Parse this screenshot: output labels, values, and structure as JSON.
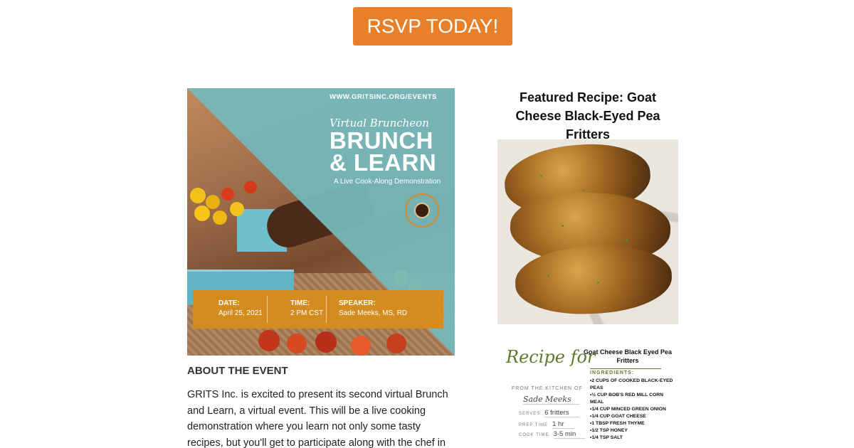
{
  "rsvp_button": {
    "label": "RSVP TODAY!",
    "color": "#e8802a"
  },
  "flyer": {
    "url": "WWW.GRITSINC.ORG/EVENTS",
    "script_title": "Virtual Bruncheon",
    "title_line1": "BRUNCH",
    "title_line2": "& LEARN",
    "subtitle": "A Live Cook-Along Demonstration",
    "info": [
      {
        "label": "DATE:",
        "value": "April 25, 2021"
      },
      {
        "label": "TIME:",
        "value": "2 PM CST"
      },
      {
        "label": "SPEAKER:",
        "value": "Sade Meeks, MS, RD"
      }
    ]
  },
  "about": {
    "heading": "ABOUT THE EVENT",
    "body": "GRITS Inc. is excited to present its second virtual Brunch and Learn, a virtual event. This will be a live cooking demonstration where you learn not only some tasty recipes, but you'll get to participate along with the chef in real-time."
  },
  "featured": {
    "title": "Featured Recipe: Goat Cheese Black-Eyed Pea Fritters"
  },
  "recipe_card": {
    "recipe_for": "Recipe for",
    "recipe_title": "Goat Cheese Black Eyed Pea Fritters",
    "from_kitchen": "FROM THE KITCHEN OF",
    "chef": "Sade Meeks",
    "serves_label": "SERVES",
    "serves": "6 fritters",
    "prep_label": "PREP TIME",
    "prep": "1 hr",
    "cook_label": "COOK TIME",
    "cook": "3-5 min",
    "ingredients_heading": "INGREDIENTS:",
    "ingredients": [
      "2 CUPS OF COOKED BLACK-EYED PEAS",
      "½ CUP BOB'S RED MILL CORN MEAL",
      "1/4 CUP MINCED GREEN ONION",
      "1/4 CUP GOAT CHEESE",
      "1 TBSP FRESH THYME",
      "1/2 TSP HONEY",
      "1/4 TSP SALT"
    ]
  }
}
